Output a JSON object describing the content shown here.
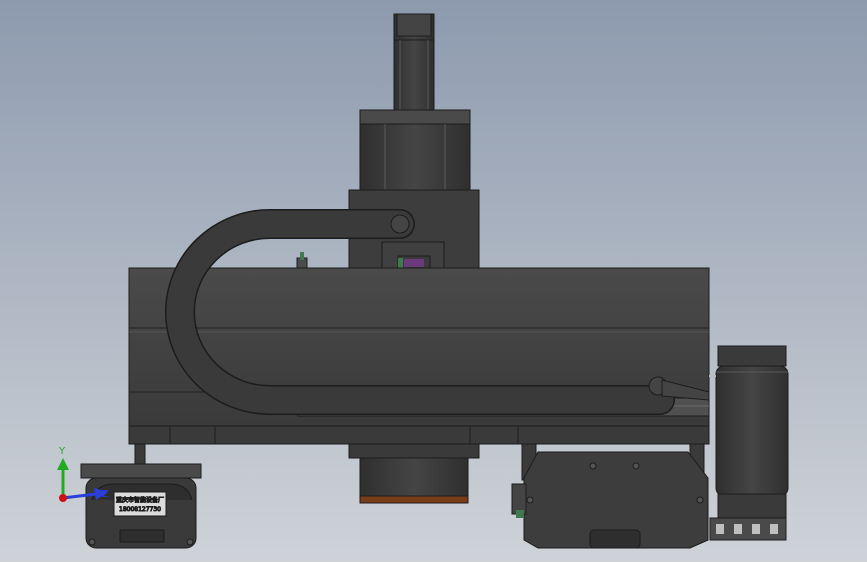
{
  "view": {
    "background_top": "#8d9aae",
    "background_bottom": "#cfd3d8"
  },
  "colors": {
    "body_dark": "#3b3b3b",
    "body_mid": "#464646",
    "body_light": "#555555",
    "edge": "#1c1c1c",
    "highlight": "#6a6a6a",
    "copper": "#7a3d1a",
    "axis_y": "#22aa22",
    "axis_z": "#2a3fd8",
    "axis_origin": "#cc1111",
    "accent_purple": "#6a3a7a",
    "accent_green": "#3f7a4f"
  },
  "triad": {
    "y_label": "Y",
    "z_label": "Z"
  },
  "nameplate": {
    "line1": "重庆市智能设备厂",
    "line2": "18008127730"
  },
  "icons": [
    "coordinate-triad-icon"
  ]
}
